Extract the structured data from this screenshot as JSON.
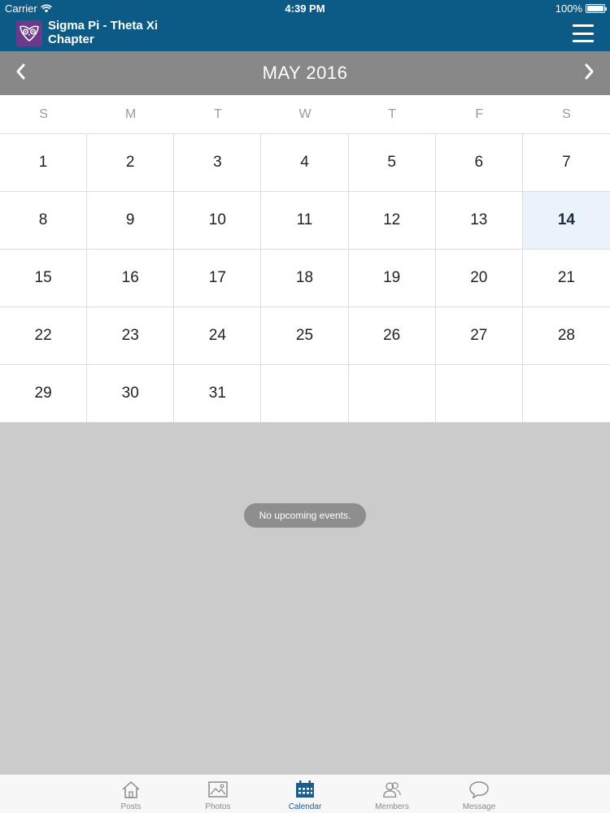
{
  "status_bar": {
    "carrier": "Carrier",
    "time": "4:39 PM",
    "battery": "100%"
  },
  "app_bar": {
    "title_line1": "Sigma Pi - Theta Xi",
    "title_line2": "Chapter",
    "logo_icon": "owl-icon",
    "menu_icon": "hamburger-menu-icon"
  },
  "month_bar": {
    "title": "MAY 2016",
    "prev_icon": "chevron-left-icon",
    "next_icon": "chevron-right-icon"
  },
  "weekdays": [
    "S",
    "M",
    "T",
    "W",
    "T",
    "F",
    "S"
  ],
  "calendar": {
    "days": [
      "1",
      "2",
      "3",
      "4",
      "5",
      "6",
      "7",
      "8",
      "9",
      "10",
      "11",
      "12",
      "13",
      "14",
      "15",
      "16",
      "17",
      "18",
      "19",
      "20",
      "21",
      "22",
      "23",
      "24",
      "25",
      "26",
      "27",
      "28",
      "29",
      "30",
      "31",
      "",
      "",
      "",
      ""
    ],
    "today": "14"
  },
  "events": {
    "empty_message": "No upcoming events."
  },
  "tabs": [
    {
      "label": "Posts",
      "icon": "home-icon"
    },
    {
      "label": "Photos",
      "icon": "photo-icon"
    },
    {
      "label": "Calendar",
      "icon": "calendar-icon"
    },
    {
      "label": "Members",
      "icon": "members-icon"
    },
    {
      "label": "Message",
      "icon": "message-icon"
    }
  ],
  "active_tab": "Calendar",
  "colors": {
    "header_blue": "#0c5a86",
    "month_bar_gray": "#888888",
    "today_highlight": "#eaf2fb",
    "active_tab": "#1b5e8c",
    "logo_purple": "#6b3a8c"
  }
}
